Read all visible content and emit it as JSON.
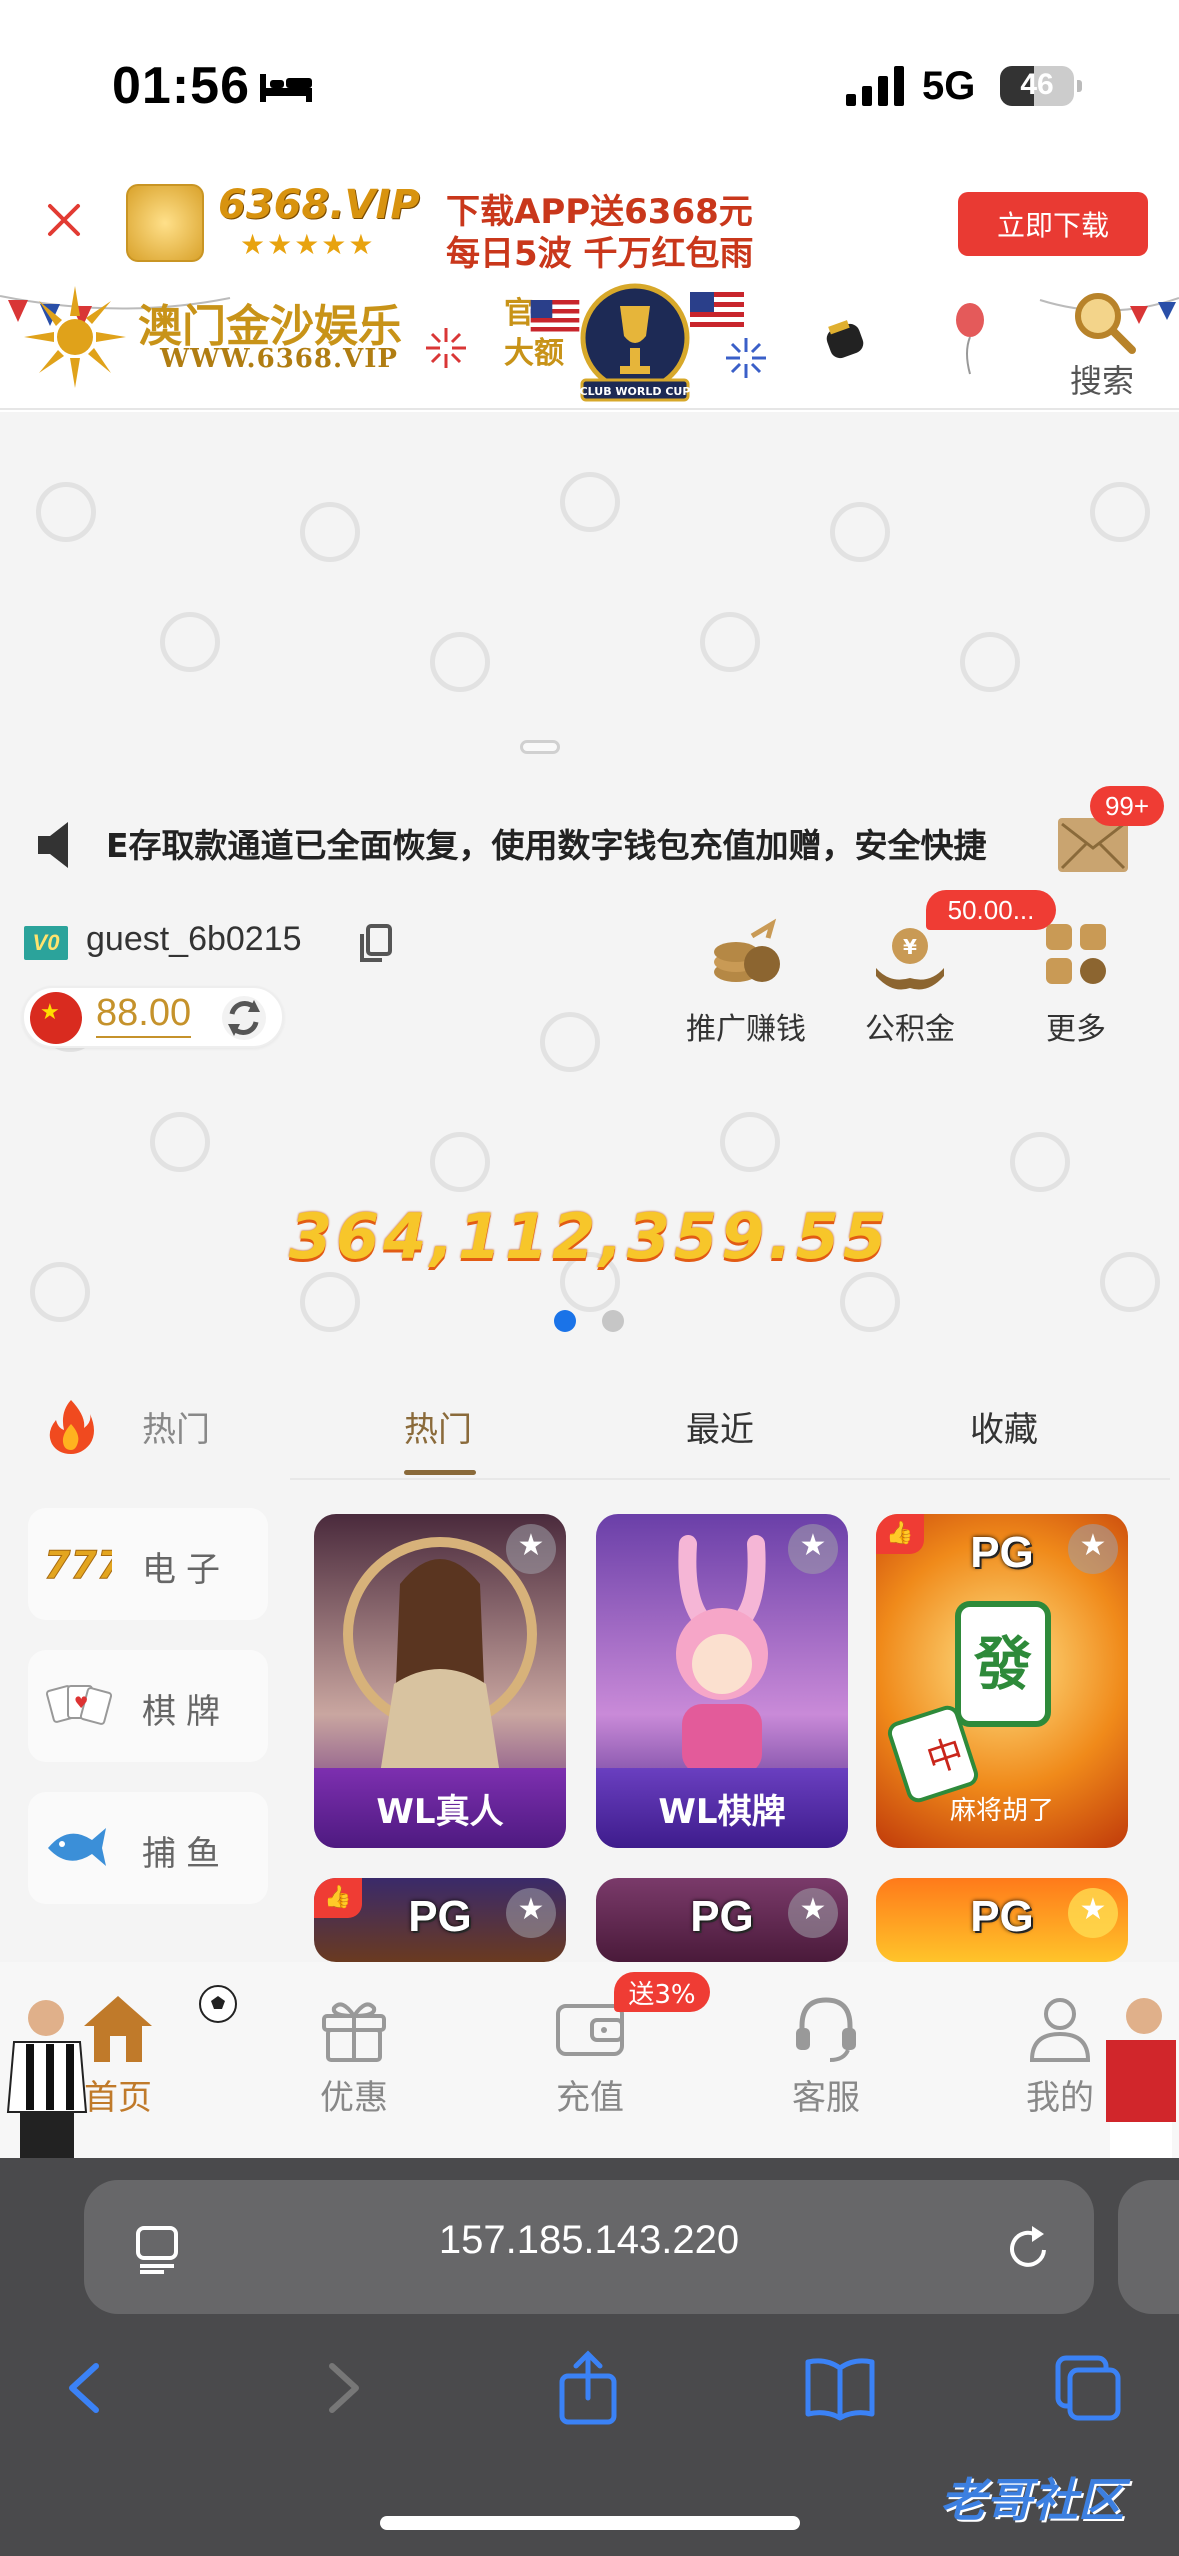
{
  "status_bar": {
    "time": "01:56",
    "network": "5G",
    "battery": "46"
  },
  "ad_banner": {
    "logo_text": "6368.VIP",
    "stars": "★★★★★",
    "promo_line1": "下载APP送6368元",
    "promo_line2": "每日5波 千万红包雨",
    "download_label": "立即下载"
  },
  "header": {
    "brand_name": "澳门金沙娱乐",
    "brand_url": "WWW.6368.VIP",
    "side_text": "官\n大额",
    "trophy_text": "CLUB WORLD CUP",
    "search_label": "搜索"
  },
  "marquee": {
    "text": "E存取款通道已全面恢复，使用数字钱包充值加赠，安全快捷",
    "mail_badge": "99+"
  },
  "user": {
    "vip_level": "V0",
    "username": "guest_6b0215",
    "balance": "88.00"
  },
  "quick_actions": [
    {
      "label": "推广赚钱",
      "icon": "coins-icon"
    },
    {
      "label": "公积金",
      "icon": "fund-icon",
      "badge": "50.00..."
    },
    {
      "label": "更多",
      "icon": "more-grid-icon"
    }
  ],
  "jackpot": {
    "value": "364,112,359.55"
  },
  "carousel": {
    "total": 2,
    "active": 0,
    "active_color": "#1a73e8",
    "inactive_color": "#c6c6c6"
  },
  "category_tabs": {
    "hot_label": "热门",
    "tabs": [
      "热门",
      "最近",
      "收藏"
    ],
    "active_tab": 0
  },
  "side_categories": [
    {
      "label": "电子",
      "icon": "slot-777-icon"
    },
    {
      "label": "棋牌",
      "icon": "cards-icon"
    },
    {
      "label": "捕鱼",
      "icon": "fish-icon"
    }
  ],
  "games": [
    {
      "name": "WL真人",
      "provider_badge": "WL"
    },
    {
      "name": "WL棋牌",
      "provider_badge": "WL"
    },
    {
      "name": "麻将胡了",
      "provider_badge": "PG"
    },
    {
      "name": "",
      "provider_badge": "PG"
    },
    {
      "name": "",
      "provider_badge": "PG"
    },
    {
      "name": "",
      "provider_badge": "PG"
    }
  ],
  "bottom_nav": {
    "items": [
      {
        "label": "首页",
        "icon": "home-icon"
      },
      {
        "label": "优惠",
        "icon": "gift-icon"
      },
      {
        "label": "充值",
        "icon": "wallet-icon"
      },
      {
        "label": "客服",
        "icon": "headset-icon"
      },
      {
        "label": "我的",
        "icon": "user-icon"
      }
    ],
    "active": 0,
    "recharge_badge": "送3%",
    "active_color": "#c07a2a"
  },
  "safari": {
    "url": "157.185.143.220"
  },
  "watermark": "老哥社区"
}
